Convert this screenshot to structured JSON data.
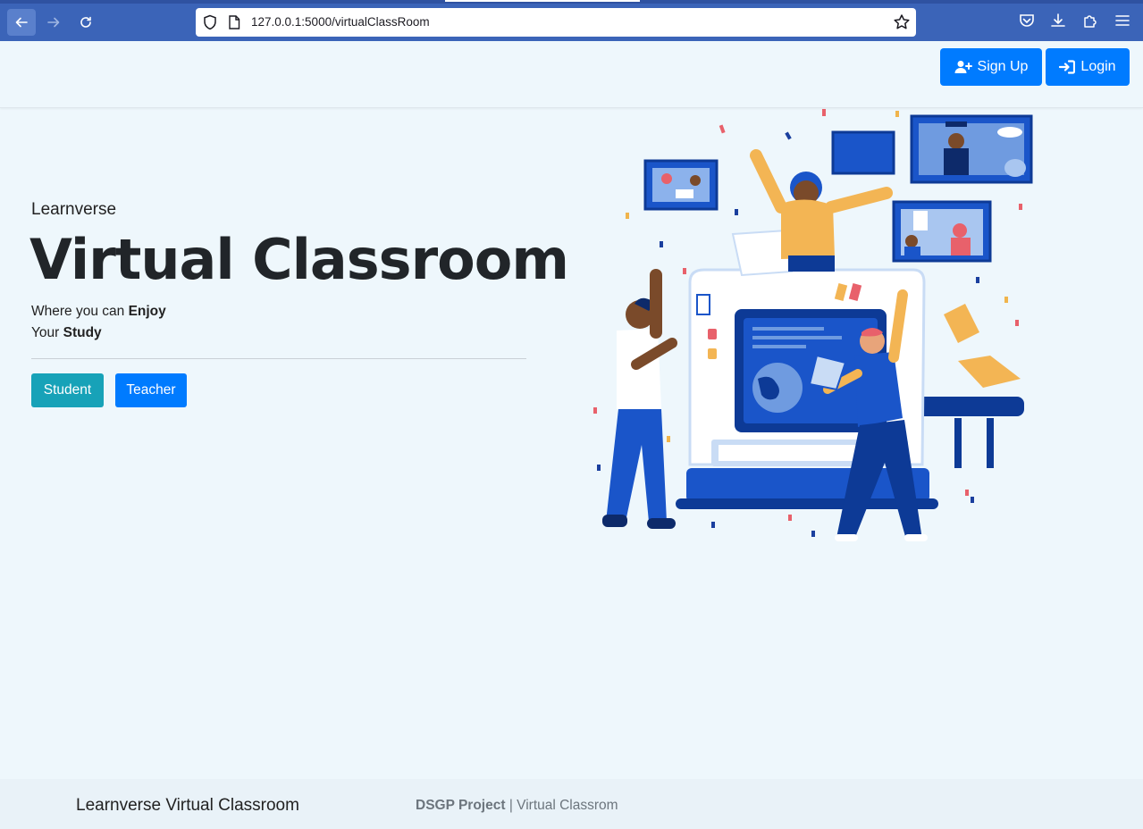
{
  "browser": {
    "url": "127.0.0.1:5000/virtualClassRoom"
  },
  "header": {
    "signup_label": "Sign Up",
    "login_label": "Login"
  },
  "hero": {
    "brand": "Learnverse",
    "title": "Virtual Classroom",
    "line1_prefix": "Where you can ",
    "line1_bold": "Enjoy",
    "line2_prefix": "Your ",
    "line2_bold": "Study",
    "student_label": "Student",
    "teacher_label": "Teacher"
  },
  "footer": {
    "brand": "Learnverse Virtual Classroom",
    "project_bold": "DSGP Project",
    "project_rest": " | Virtual Classrom"
  },
  "colors": {
    "primary": "#007bff",
    "info": "#17a2b8",
    "page_bg": "#eef7fc",
    "browser_bar": "#3b64b8"
  },
  "icons": [
    "back-arrow-icon",
    "forward-arrow-icon",
    "reload-icon",
    "shield-icon",
    "page-icon",
    "bookmark-star-icon",
    "pocket-icon",
    "download-icon",
    "extensions-icon",
    "menu-icon",
    "user-plus-icon",
    "sign-in-icon"
  ]
}
